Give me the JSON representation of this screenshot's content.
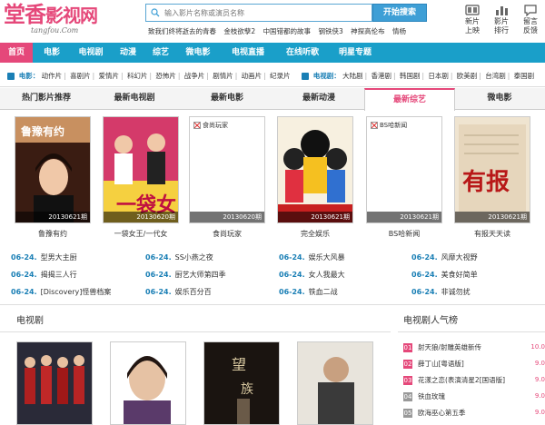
{
  "header": {
    "logo_text": "堂香",
    "logo_sub": "影视网",
    "logo_domain": "tangfou.Com",
    "search_placeholder": "输入影片名称或演员名称",
    "search_button": "开始搜索",
    "hot_links": [
      "致我们终将逝去的青春",
      "金枝欲孽2",
      "中国错都的故事",
      "钢铁侠3",
      "神探高伦布",
      "情杨"
    ],
    "top_icons": [
      {
        "label1": "新片",
        "label2": "上映",
        "icon": "film-icon"
      },
      {
        "label1": "影片",
        "label2": "排行",
        "icon": "chart-icon"
      },
      {
        "label1": "留言",
        "label2": "反馈",
        "icon": "message-icon"
      }
    ]
  },
  "nav": {
    "items": [
      "首页",
      "电影",
      "电视剧",
      "动漫",
      "综艺",
      "微电影",
      "电视直播",
      "在线听歌",
      "明星专题"
    ],
    "active_index": 0
  },
  "subnav": {
    "movie_label": "电影：",
    "movie_items": [
      "动作片",
      "喜剧片",
      "爱情片",
      "科幻片",
      "恐怖片",
      "战争片",
      "剧情片",
      "动画片",
      "纪录片"
    ],
    "tv_label": "电视剧：",
    "tv_items": [
      "大陆剧",
      "香港剧",
      "韩国剧",
      "日本剧",
      "欧美剧",
      "台湾剧",
      "泰国剧"
    ]
  },
  "tabs": {
    "items": [
      "热门影片推荐",
      "最新电视剧",
      "最新电影",
      "最新动漫",
      "最新综艺",
      "微电影"
    ],
    "active_index": 4
  },
  "posters": [
    {
      "title": "鲁豫有约",
      "ep": "20130621期",
      "broken": ""
    },
    {
      "title": "一袋女王/一代女",
      "ep": "20130620期",
      "broken": ""
    },
    {
      "title": "食尚玩家",
      "ep": "20130620期",
      "broken": "食尚玩家"
    },
    {
      "title": "完全娱乐",
      "ep": "20130621期",
      "broken": ""
    },
    {
      "title": "BS哈新闻",
      "ep": "20130621期",
      "broken": "BS哈新闻"
    },
    {
      "title": "有报天天读",
      "ep": "20130621期",
      "broken": ""
    }
  ],
  "latest": [
    [
      {
        "date": "06-24.",
        "title": "型男大主厨"
      },
      {
        "date": "06-24.",
        "title": "揭揭三人行"
      },
      {
        "date": "06-24.",
        "title": "[Discovery]怪兽档案"
      }
    ],
    [
      {
        "date": "06-24.",
        "title": "SS小燕之夜"
      },
      {
        "date": "06-24.",
        "title": "厨艺大师第四季"
      },
      {
        "date": "06-24.",
        "title": "娱乐百分百"
      }
    ],
    [
      {
        "date": "06-24.",
        "title": "娱乐大风暴"
      },
      {
        "date": "06-24.",
        "title": "女人我最大"
      },
      {
        "date": "06-24.",
        "title": "铁血二战"
      }
    ],
    [
      {
        "date": "06-24.",
        "title": "风靡大视野"
      },
      {
        "date": "06-24.",
        "title": "美食好简单"
      },
      {
        "date": "06-24.",
        "title": "非诚勿扰"
      }
    ]
  ],
  "tv_section": {
    "title": "电视剧"
  },
  "ranking": {
    "title": "电视剧人气榜",
    "items": [
      {
        "num": "01",
        "title": "射天狼/射雕英雄新传",
        "score": "10.0"
      },
      {
        "num": "02",
        "title": "薛丁山[粤语版]",
        "score": "9.0"
      },
      {
        "num": "03",
        "title": "花漾之恋(表演清星2[国语版]",
        "score": "9.0"
      },
      {
        "num": "04",
        "title": "铁血玫瑰",
        "score": "9.0"
      },
      {
        "num": "05",
        "title": "欧海巫心第五季",
        "score": "9.0"
      }
    ]
  },
  "colors": {
    "brand_pink": "#e5487a",
    "nav_blue": "#1a9fc9",
    "link_blue": "#1a7fb5"
  }
}
